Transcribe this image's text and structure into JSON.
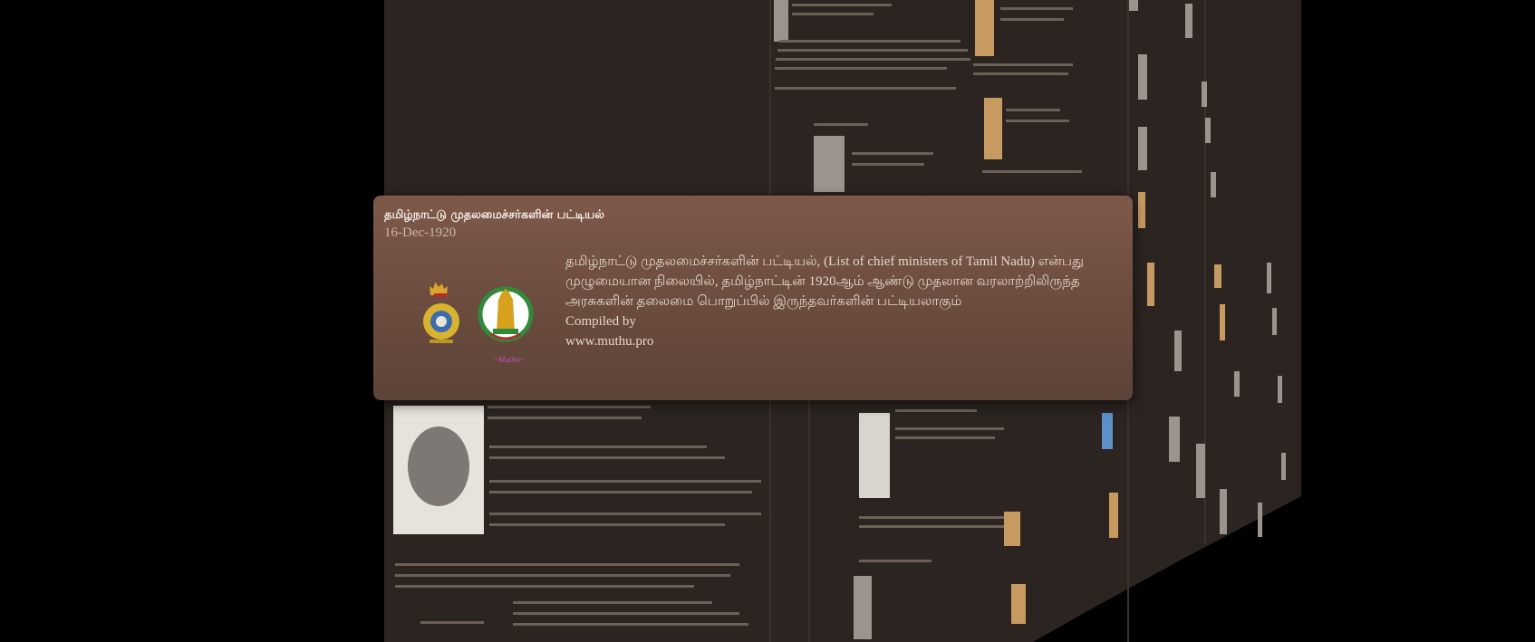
{
  "popup": {
    "title": "தமிழ்நாட்டு முதலமைச்சர்களின் பட்டியல்",
    "date": "16-Dec-1920",
    "description": "தமிழ்நாட்டு முதலமைச்சர்களின் பட்டியல், (List of chief ministers of Tamil Nadu) என்பது முழுமையான நிலையில், தமிழ்நாட்டின் 1920ஆம் ஆண்டு முதலான வரலாற்றிலிருந்த அரசுகளின் தலைமை பொறுப்பில் இருந்தவர்களின் பட்டியலாகும்",
    "compiled_by": "Compiled by",
    "url": "www.muthu.pro",
    "logos": [
      "madras-presidency-emblem-icon",
      "tamil-nadu-emblem-icon"
    ]
  },
  "colors": {
    "background": "#000000",
    "wall": "#2b2420",
    "card": "#6e4e40"
  }
}
